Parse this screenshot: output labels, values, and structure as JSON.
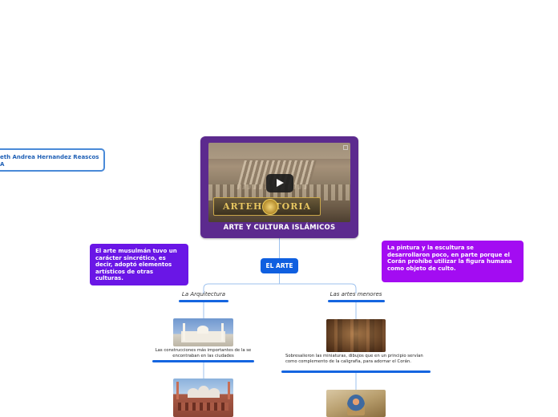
{
  "author_node": {
    "label": "eth Andrea Hernandez Reascos\nA"
  },
  "central_topic": {
    "title": "ARTE Y CULTURA ISLÁMICOS",
    "video": {
      "brand": "ARTEHISTORIA",
      "control": "play-icon"
    }
  },
  "main_node": {
    "label": "EL ARTE"
  },
  "callouts": {
    "left": "El arte musulmán tuvo un carácter sincrético, es decir, adoptó elementos artísticos de otras culturas.",
    "right": "La pintura y la escultura se desarrollaron poco, en parte porque el Corán prohíbe utilizar la figura humana como objeto de culto."
  },
  "branches": [
    {
      "label": "La Arquitectura",
      "description": "Las construcciones más importantes de la se encontraban en las ciudades"
    },
    {
      "label": "Las artes menores",
      "description": "Sobresalieron las miniaturas, dibujos que en un principio servían como complemento de la caligrafía, para adornar el Corán."
    }
  ],
  "colors": {
    "central": "#5c2a8e",
    "main_node": "#0f5fe0",
    "callout_left": "#6a16e6",
    "callout_right": "#a30cf2",
    "connector": "#9ec2ee",
    "underline": "#1565e0"
  }
}
